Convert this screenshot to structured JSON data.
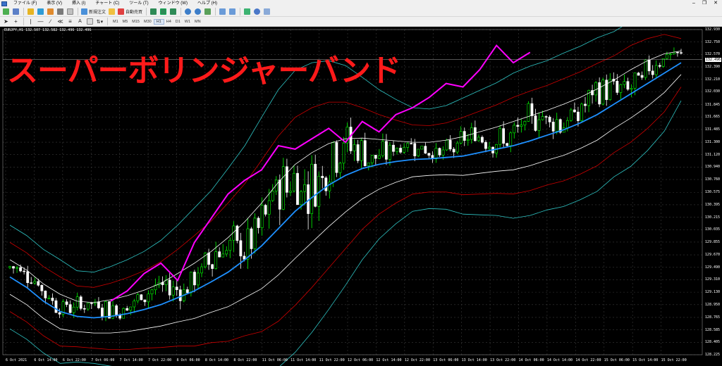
{
  "menu": {
    "items": [
      "ファイル (F)",
      "表示 (V)",
      "挿入 (I)",
      "チャート (C)",
      "ツール (T)",
      "ウィンドウ (W)",
      "ヘルプ (H)"
    ]
  },
  "toolbar": {
    "new_order_label": "新規注文",
    "auto_trade_label": "自動売買",
    "timeframes": [
      "M1",
      "M5",
      "M15",
      "M30",
      "H1",
      "H4",
      "D1",
      "W1",
      "MN"
    ],
    "active_timeframe": "H1"
  },
  "chart": {
    "symbol_info": "EURJPY,H1  132.507 132.582 132.496 132.496",
    "overlay_title": "スーパーボリンジャーバンド",
    "current_price": "132.496",
    "y_ticks": [
      "132.930",
      "132.750",
      "132.570",
      "132.390",
      "132.210",
      "132.030",
      "131.845",
      "131.665",
      "131.485",
      "131.300",
      "131.120",
      "130.940",
      "130.760",
      "130.575",
      "130.395",
      "130.215",
      "130.035",
      "129.855",
      "129.670",
      "129.490",
      "129.310",
      "129.130",
      "128.950",
      "128.765",
      "128.585",
      "128.405",
      "128.225"
    ],
    "x_ticks": [
      "6 Oct 2021",
      "6 Oct 14:00",
      "6 Oct 22:00",
      "7 Oct 06:00",
      "7 Oct 14:00",
      "7 Oct 22:00",
      "8 Oct 06:00",
      "8 Oct 14:00",
      "8 Oct 22:00",
      "11 Oct 06:00",
      "11 Oct 14:00",
      "11 Oct 22:00",
      "12 Oct 06:00",
      "12 Oct 14:00",
      "12 Oct 22:00",
      "13 Oct 06:00",
      "13 Oct 14:00",
      "13 Oct 22:00",
      "14 Oct 06:00",
      "14 Oct 14:00",
      "14 Oct 22:00",
      "15 Oct 06:00",
      "15 Oct 14:00",
      "15 Oct 22:00"
    ],
    "colors": {
      "background": "#000000",
      "grid": "#3a3a3a",
      "candle_up": "#00ff00",
      "candle_down": "#ffffff",
      "middle_band": "#1e90ff",
      "band_1sigma": "#ffffff",
      "band_2sigma": "#cc0000",
      "band_3sigma": "#2ec4c4",
      "chikou_span": "#ff00ff"
    }
  },
  "chart_data": {
    "type": "line",
    "ylim": [
      128.225,
      132.93
    ],
    "middle": [
      129.35,
      129.2,
      129.0,
      128.85,
      128.78,
      128.76,
      128.78,
      128.82,
      128.88,
      128.95,
      129.05,
      129.15,
      129.28,
      129.42,
      129.6,
      129.8,
      130.05,
      130.3,
      130.5,
      130.68,
      130.82,
      130.92,
      130.98,
      131.02,
      131.05,
      131.06,
      131.08,
      131.1,
      131.15,
      131.2,
      131.25,
      131.32,
      131.4,
      131.48,
      131.58,
      131.7,
      131.85,
      132.0,
      132.15,
      132.3,
      132.45
    ],
    "upper1": [
      129.6,
      129.45,
      129.25,
      129.1,
      129.0,
      128.98,
      129.02,
      129.08,
      129.16,
      129.26,
      129.4,
      129.55,
      129.72,
      129.92,
      130.15,
      130.42,
      130.72,
      130.98,
      131.15,
      131.28,
      131.35,
      131.36,
      131.34,
      131.32,
      131.3,
      131.3,
      131.33,
      131.38,
      131.45,
      131.52,
      131.6,
      131.68,
      131.76,
      131.85,
      131.95,
      132.07,
      132.2,
      132.35,
      132.48,
      132.58,
      132.62
    ],
    "lower1": [
      129.1,
      128.95,
      128.75,
      128.6,
      128.56,
      128.54,
      128.54,
      128.56,
      128.6,
      128.64,
      128.7,
      128.75,
      128.84,
      128.92,
      129.05,
      129.18,
      129.38,
      129.62,
      129.85,
      130.08,
      130.29,
      130.48,
      130.62,
      130.72,
      130.8,
      130.82,
      130.83,
      130.82,
      130.85,
      130.88,
      130.9,
      130.96,
      131.04,
      131.11,
      131.21,
      131.33,
      131.5,
      131.65,
      131.82,
      132.02,
      132.28
    ],
    "upper2": [
      129.85,
      129.7,
      129.5,
      129.35,
      129.22,
      129.2,
      129.26,
      129.34,
      129.44,
      129.57,
      129.75,
      129.95,
      130.16,
      130.42,
      130.7,
      131.04,
      131.39,
      131.66,
      131.8,
      131.88,
      131.88,
      131.8,
      131.7,
      131.62,
      131.55,
      131.54,
      131.58,
      131.66,
      131.75,
      131.84,
      131.95,
      132.04,
      132.12,
      132.22,
      132.32,
      132.44,
      132.55,
      132.7,
      132.8,
      132.86,
      132.8
    ],
    "lower2": [
      128.85,
      128.7,
      128.5,
      128.35,
      128.34,
      128.32,
      128.3,
      128.3,
      128.32,
      128.33,
      128.35,
      128.35,
      128.4,
      128.42,
      128.5,
      128.56,
      128.71,
      128.94,
      129.2,
      129.48,
      129.76,
      130.04,
      130.26,
      130.42,
      130.55,
      130.58,
      130.58,
      130.54,
      130.55,
      130.56,
      130.55,
      130.6,
      130.68,
      130.74,
      130.84,
      130.96,
      131.15,
      131.3,
      131.5,
      131.74,
      132.1
    ],
    "upper3": [
      130.1,
      129.95,
      129.75,
      129.6,
      129.44,
      129.42,
      129.5,
      129.6,
      129.72,
      129.88,
      130.1,
      130.35,
      130.6,
      130.92,
      131.25,
      131.66,
      132.06,
      132.34,
      132.45,
      132.48,
      132.41,
      132.24,
      132.06,
      131.92,
      131.8,
      131.78,
      131.83,
      131.94,
      132.05,
      132.16,
      132.3,
      132.4,
      132.48,
      132.59,
      132.69,
      132.81,
      132.9,
      133.05,
      133.12,
      133.14,
      133.0
    ],
    "lower3": [
      128.6,
      128.45,
      128.25,
      128.1,
      128.12,
      128.1,
      128.06,
      128.04,
      128.04,
      128.02,
      128.0,
      127.95,
      127.96,
      127.92,
      127.95,
      127.94,
      128.04,
      128.26,
      128.55,
      128.88,
      129.23,
      129.6,
      129.9,
      130.12,
      130.3,
      130.34,
      130.33,
      130.26,
      130.25,
      130.24,
      130.2,
      130.24,
      130.32,
      130.37,
      130.47,
      130.59,
      130.8,
      130.95,
      131.18,
      131.46,
      131.9
    ],
    "chikou": [
      null,
      null,
      null,
      null,
      null,
      null,
      129.0,
      129.15,
      129.4,
      129.55,
      129.3,
      129.85,
      130.2,
      130.55,
      130.75,
      130.9,
      131.25,
      131.2,
      131.35,
      131.5,
      131.3,
      131.6,
      131.45,
      131.7,
      131.8,
      131.95,
      132.15,
      132.1,
      132.35,
      132.7,
      132.45,
      132.6,
      null,
      null,
      null,
      null,
      null,
      null,
      null,
      null,
      null
    ]
  }
}
